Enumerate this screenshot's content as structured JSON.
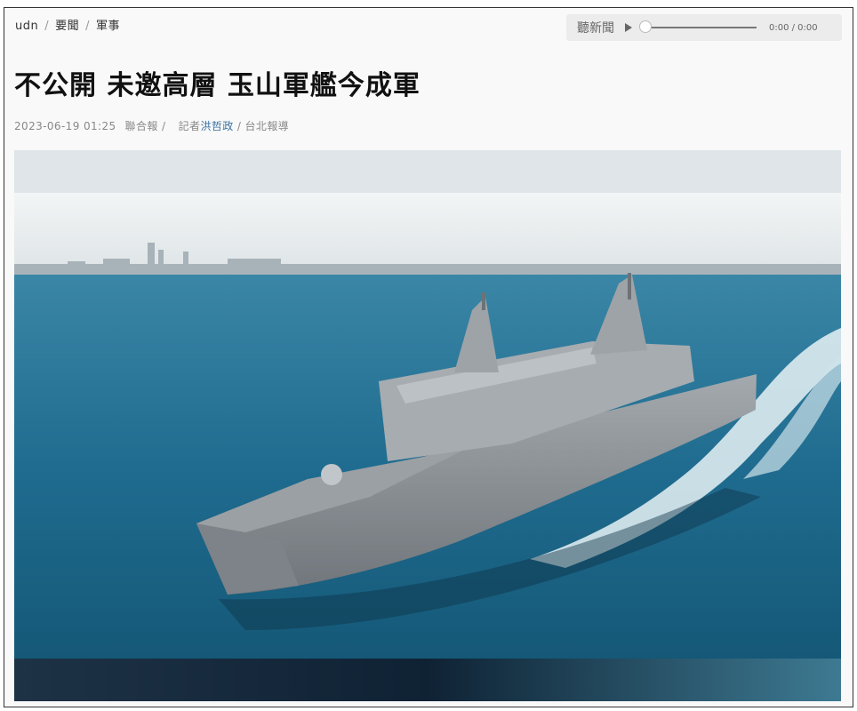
{
  "breadcrumb": {
    "items": [
      "udn",
      "要聞",
      "軍事"
    ],
    "separator": "/"
  },
  "audio_player": {
    "label": "聽新聞",
    "time": "0:00 / 0:00",
    "progress": 0
  },
  "article": {
    "title": "不公開 未邀高層 玉山軍艦今成軍",
    "datetime": "2023-06-19 01:25",
    "source": "聯合報",
    "reporter_prefix": "記者",
    "reporter": "洪哲政",
    "location": "台北報導"
  },
  "colors": {
    "sea": "#1e6f93",
    "ship": "#8c9196",
    "link": "#3a6fa0"
  }
}
